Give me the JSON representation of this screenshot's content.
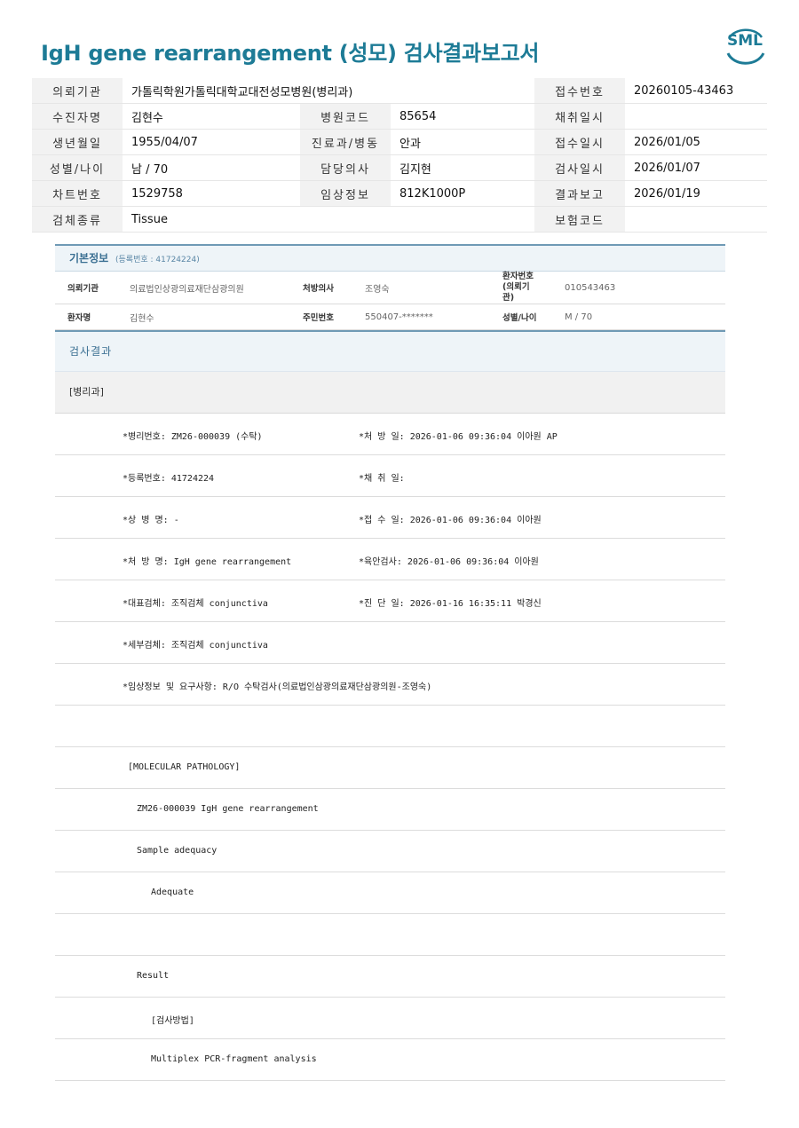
{
  "title": "IgH gene rearrangement (성모) 검사결과보고서",
  "logo": {
    "text": "SML",
    "color": "#1d7b96"
  },
  "top_info": {
    "rows": [
      [
        {
          "label": "의뢰기관",
          "value": "가톨릭학원가톨릭대학교대전성모병원(병리과)"
        },
        null,
        {
          "label": "접수번호",
          "value": "20260105-43463"
        }
      ],
      [
        {
          "label": "수진자명",
          "value": "김현수"
        },
        {
          "label": "병원코드",
          "value": "85654"
        },
        {
          "label": "채취일시",
          "value": ""
        }
      ],
      [
        {
          "label": "생년월일",
          "value": "1955/04/07"
        },
        {
          "label": "진료과/병동",
          "value": "안과"
        },
        {
          "label": "접수일시",
          "value": "2026/01/05"
        }
      ],
      [
        {
          "label": "성별/나이",
          "value": "남 / 70"
        },
        {
          "label": "담당의사",
          "value": "김지현"
        },
        {
          "label": "검사일시",
          "value": "2026/01/07"
        }
      ],
      [
        {
          "label": "차트번호",
          "value": "1529758"
        },
        {
          "label": "임상정보",
          "value": "812K1000P"
        },
        {
          "label": "결과보고",
          "value": "2026/01/19"
        }
      ],
      [
        {
          "label": "검체종류",
          "value": "Tissue"
        },
        null,
        {
          "label": "보험코드",
          "value": ""
        }
      ]
    ]
  },
  "basic_info": {
    "title": "기본정보",
    "subtitle": "(등록번호 : 41724224)",
    "rows": [
      [
        "의뢰기관",
        "의료법인상광의료재단삼광의원",
        "처방의사",
        "조영숙",
        "환자번호\n(의뢰기관)",
        "010543463"
      ],
      [
        "환자명",
        "김현수",
        "주민번호",
        "550407-*******",
        "성별/나이",
        "M / 70"
      ]
    ]
  },
  "result_section_title": "검사결과",
  "department": "[병리과]",
  "result_lines": [
    {
      "c1": "*병리번호: ZM26-000039 (수탁)",
      "c2": "*처 방 일: 2026-01-06 09:36:04  이아원 AP",
      "indent": 76
    },
    {
      "c1": "*등록번호: 41724224",
      "c2": "*채 취 일:",
      "indent": 76
    },
    {
      "c1": "*상 병 명: -",
      "c2": "*접 수 일: 2026-01-06 09:36:04  이아원",
      "indent": 76
    },
    {
      "c1": "*처 방 명: IgH gene rearrangement",
      "c2": "*육안검사: 2026-01-06 09:36:04  이아원",
      "indent": 76
    },
    {
      "c1": "*대표검체: 조직검체 conjunctiva",
      "c2": "*진 단 일: 2026-01-16 16:35:11  박경신",
      "indent": 76
    },
    {
      "c1": "*세부검체: 조직검체 conjunctiva",
      "c2": "",
      "indent": 76
    },
    {
      "c1": "*임상정보 및 요구사항: R/O 수탁검사(의료법인삼광의료재단삼광의원-조영숙)",
      "c2": "",
      "indent": 76
    },
    {
      "c1": "",
      "c2": "",
      "indent": 76
    },
    {
      "c1": "[MOLECULAR PATHOLOGY]",
      "c2": "",
      "indent": 82
    },
    {
      "c1": "ZM26-000039     IgH gene rearrangement",
      "c2": "",
      "indent": 92
    },
    {
      "c1": "Sample adequacy",
      "c2": "",
      "indent": 92
    },
    {
      "c1": "Adequate",
      "c2": "",
      "indent": 108
    },
    {
      "c1": "",
      "c2": "",
      "indent": 92
    },
    {
      "c1": "Result",
      "c2": "",
      "indent": 92
    },
    {
      "c1": "[검사방법]",
      "c2": "",
      "indent": 108
    },
    {
      "c1": "Multiplex PCR-fragment analysis",
      "c2": "",
      "indent": 108
    }
  ]
}
